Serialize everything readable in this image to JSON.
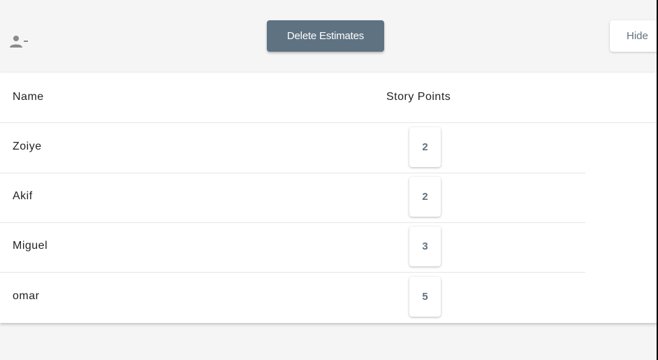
{
  "toolbar": {
    "remove_user_icon": "person-remove-icon",
    "delete_label": "Delete Estimates",
    "hide_label": "Hide"
  },
  "table": {
    "headers": {
      "name": "Name",
      "story_points": "Story Points"
    },
    "rows": [
      {
        "name": "Zoiye",
        "points": "2"
      },
      {
        "name": "Akif",
        "points": "2"
      },
      {
        "name": "Miguel",
        "points": "3"
      },
      {
        "name": "omar",
        "points": "5"
      }
    ]
  },
  "colors": {
    "accent": "#5f7282",
    "background": "#f5f5f5",
    "card": "#ffffff"
  }
}
